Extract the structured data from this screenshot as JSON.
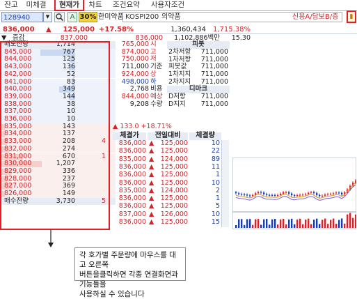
{
  "tabs": [
    {
      "label": "잔고"
    },
    {
      "label": "미체결"
    },
    {
      "label": "현재가"
    },
    {
      "label": "차트"
    },
    {
      "label": "조건요약"
    },
    {
      "label": "사용자조건"
    }
  ],
  "toolbar": {
    "code": "128940",
    "pct_badge": "30%",
    "stock_name": "한미약품",
    "market": "KOSPI200",
    "sector": "의약품",
    "credit_info": "신용A/담보B/증"
  },
  "summary": {
    "price": "836,000",
    "change": "125,000",
    "change_pct": "+17.58%",
    "volume": "1,360,434",
    "volume_pct": "1,715.38%",
    "label_increase": "증감",
    "prev_price": "837,000",
    "second_price": "836,000",
    "trade_value": "1,102,886백만",
    "trade_count": "15.30"
  },
  "orderbook": {
    "ask_header": "매도잔량",
    "ask_header_value": "1,714",
    "asks": [
      {
        "price": "845,000",
        "qty": "767"
      },
      {
        "price": "844,000",
        "qty": "125"
      },
      {
        "price": "843,000",
        "qty": "136"
      },
      {
        "price": "842,000",
        "qty": "52"
      },
      {
        "price": "841,000",
        "qty": "83"
      },
      {
        "price": "840,000",
        "qty": "349"
      },
      {
        "price": "839,000",
        "qty": "144"
      },
      {
        "price": "838,000",
        "qty": "38"
      },
      {
        "price": "837,000",
        "qty": "10"
      },
      {
        "price": "836,000",
        "qty": "10"
      }
    ],
    "bids": [
      {
        "price": "835,000",
        "qty": "143",
        "chg": ""
      },
      {
        "price": "834,000",
        "qty": "137",
        "chg": ""
      },
      {
        "price": "833,000",
        "qty": "208",
        "chg": "4"
      },
      {
        "price": "832,000",
        "qty": "274",
        "chg": ""
      },
      {
        "price": "831,000",
        "qty": "670",
        "chg": "1"
      },
      {
        "price": "830,000",
        "qty": "1,207",
        "chg": ""
      },
      {
        "price": "829,000",
        "qty": "336",
        "chg": ""
      },
      {
        "price": "828,000",
        "qty": "237",
        "chg": ""
      },
      {
        "price": "827,000",
        "qty": "369",
        "chg": ""
      },
      {
        "price": "826,000",
        "qty": "149",
        "chg": ""
      }
    ],
    "bid_footer_label": "매수잔량",
    "bid_footer_value": "3,730",
    "bid_footer_chg": "5"
  },
  "info": [
    {
      "value": "765,000",
      "label": "시"
    },
    {
      "value": "874,000",
      "label": "고"
    },
    {
      "value": "750,000",
      "label": "저"
    },
    {
      "value": "711,000",
      "label": "기준"
    },
    {
      "value": "924,000",
      "label": "상"
    },
    {
      "value": "498,000",
      "label": "하"
    },
    {
      "value": "2,768",
      "label": "비용"
    },
    {
      "value": "844,000",
      "label": "예상"
    },
    {
      "value": "9,208",
      "label": "수량"
    }
  ],
  "info_change": {
    "value": "133.0",
    "pct": "+18.71%"
  },
  "pivot": {
    "header": "피봇",
    "rows": [
      {
        "label": "2차저항",
        "value": "711,000"
      },
      {
        "label": "1차저항",
        "value": "711,000"
      },
      {
        "label": "피봇값",
        "value": "711,000"
      },
      {
        "label": "1차지지",
        "value": "711,000"
      },
      {
        "label": "2차지지",
        "value": "711,000"
      }
    ]
  },
  "demark": {
    "header": "디마크",
    "rows": [
      {
        "label": "D저항",
        "value": "711,000"
      },
      {
        "label": "D지지",
        "value": "711,000"
      }
    ]
  },
  "trades": {
    "headers": [
      "체결가",
      "전일대비",
      "체결량"
    ],
    "rows": [
      {
        "price": "836,000",
        "chg": "125,000",
        "qty": "10"
      },
      {
        "price": "836,000",
        "chg": "125,000",
        "qty": "22"
      },
      {
        "price": "835,000",
        "chg": "124,000",
        "qty": "89"
      },
      {
        "price": "836,000",
        "chg": "125,000",
        "qty": "11"
      },
      {
        "price": "836,000",
        "chg": "125,000",
        "qty": "1"
      },
      {
        "price": "836,000",
        "chg": "125,000",
        "qty": "10"
      },
      {
        "price": "835,000",
        "chg": "124,000",
        "qty": "2"
      },
      {
        "price": "836,000",
        "chg": "125,000",
        "qty": "1"
      },
      {
        "price": "836,000",
        "chg": "125,000",
        "qty": "5"
      },
      {
        "price": "837,000",
        "chg": "126,000",
        "qty": "10"
      },
      {
        "price": "836,000",
        "chg": "125,000",
        "qty": "15"
      }
    ]
  },
  "tooltip": {
    "text": "각 호가별 주문량에 마우스를 대고 오른쪽\n버튼을클릭하면 각종 연결화면과 기능들을\n사용하실 수 있습니다"
  },
  "colors": {
    "up": "#d0262b",
    "down": "#1a3ea8",
    "highlight": "#e21f26"
  }
}
